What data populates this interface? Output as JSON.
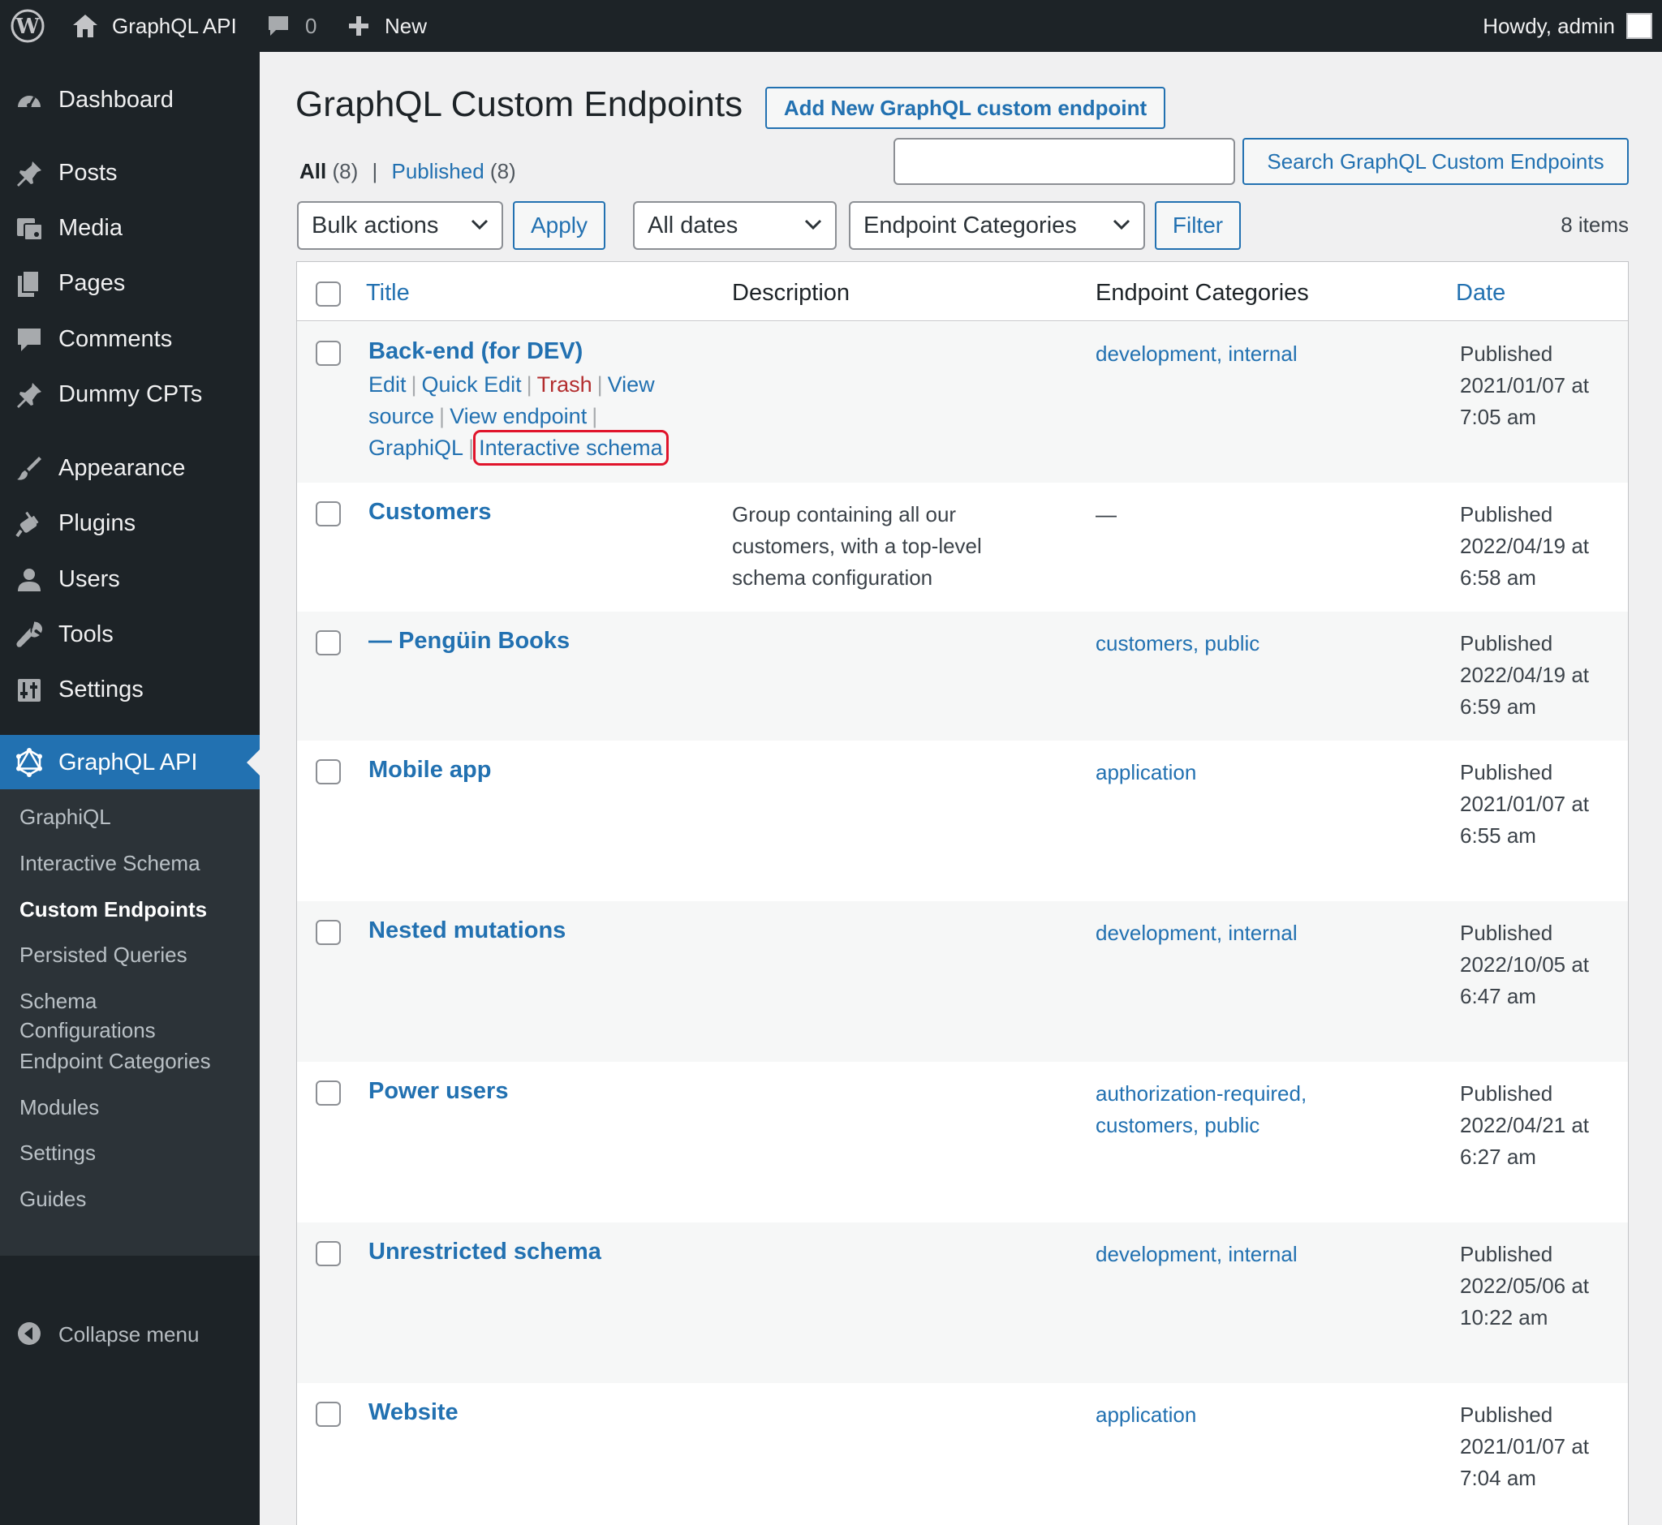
{
  "adminbar": {
    "site_name": "GraphQL API",
    "comments_count": "0",
    "new_label": "New",
    "howdy": "Howdy, admin"
  },
  "sidebar": {
    "items": [
      {
        "label": "Dashboard",
        "icon": "dashboard-icon"
      },
      {
        "label": "Posts",
        "icon": "pushpin-icon"
      },
      {
        "label": "Media",
        "icon": "media-icon"
      },
      {
        "label": "Pages",
        "icon": "pages-icon"
      },
      {
        "label": "Comments",
        "icon": "comment-icon"
      },
      {
        "label": "Dummy CPTs",
        "icon": "pushpin-icon"
      },
      {
        "label": "Appearance",
        "icon": "paintbrush-icon"
      },
      {
        "label": "Plugins",
        "icon": "plugin-icon"
      },
      {
        "label": "Users",
        "icon": "user-icon"
      },
      {
        "label": "Tools",
        "icon": "wrench-icon"
      },
      {
        "label": "Settings",
        "icon": "settings-icon"
      },
      {
        "label": "GraphQL API",
        "icon": "graphql-icon"
      }
    ],
    "submenu": [
      "GraphiQL",
      "Interactive Schema",
      "Custom Endpoints",
      "Persisted Queries",
      "Schema\nConfigurations",
      "Endpoint Categories",
      "Modules",
      "Settings",
      "Guides"
    ],
    "collapse_label": "Collapse menu"
  },
  "header": {
    "title": "GraphQL Custom Endpoints",
    "add_new_label": "Add New GraphQL custom endpoint"
  },
  "views": {
    "all_label": "All",
    "all_count": "(8)",
    "sep": "|",
    "published_label": "Published",
    "published_count": "(8)"
  },
  "search": {
    "value": "",
    "button_label": "Search GraphQL Custom Endpoints"
  },
  "filters": {
    "bulk_actions": "Bulk actions",
    "apply": "Apply",
    "dates": "All dates",
    "categories": "Endpoint Categories",
    "filter": "Filter",
    "items_count": "8 items"
  },
  "table": {
    "columns": {
      "title": "Title",
      "description": "Description",
      "categories": "Endpoint Categories",
      "date": "Date"
    },
    "row_actions": {
      "edit": "Edit",
      "quick_edit": "Quick Edit",
      "trash": "Trash",
      "view_source_1": "View",
      "view_source_2": "source",
      "view_endpoint": "View endpoint",
      "graphiql": "GraphiQL",
      "interactive_schema": "Interactive schema"
    },
    "rows": [
      {
        "title": "Back-end (for DEV)",
        "description": "",
        "categories": [
          "development",
          "internal"
        ],
        "date": [
          "Published",
          "2021/01/07 at",
          "7:05 am"
        ]
      },
      {
        "title": "Customers",
        "description": "Group containing all our customers, with a top-level schema configuration",
        "categories": [],
        "no_category": "—",
        "date": [
          "Published",
          "2022/04/19 at",
          "6:58 am"
        ]
      },
      {
        "title": "— Pengüin Books",
        "description": "",
        "categories": [
          "customers",
          "public"
        ],
        "date": [
          "Published",
          "2022/04/19 at",
          "6:59 am"
        ]
      },
      {
        "title": "Mobile app",
        "description": "",
        "categories": [
          "application"
        ],
        "date": [
          "Published",
          "2021/01/07 at",
          "6:55 am"
        ]
      },
      {
        "title": "Nested mutations",
        "description": "",
        "categories": [
          "development",
          "internal"
        ],
        "date": [
          "Published",
          "2022/10/05 at",
          "6:47 am"
        ]
      },
      {
        "title": "Power users",
        "description": "",
        "categories": [
          "authorization-required",
          "customers",
          "public"
        ],
        "date": [
          "Published",
          "2022/04/21 at",
          "6:27 am"
        ]
      },
      {
        "title": "Unrestricted schema",
        "description": "",
        "categories": [
          "development",
          "internal"
        ],
        "date": [
          "Published",
          "2022/05/06 at",
          "10:22 am"
        ]
      },
      {
        "title": "Website",
        "description": "",
        "categories": [
          "application"
        ],
        "date": [
          "Published",
          "2021/01/07 at",
          "7:04 am"
        ]
      }
    ]
  },
  "colors": {
    "admin_dark": "#1d2327",
    "submenu_bg": "#2c3338",
    "accent_blue": "#2271b1",
    "trash_red": "#b32d2e",
    "highlight_red": "#e0142b"
  }
}
